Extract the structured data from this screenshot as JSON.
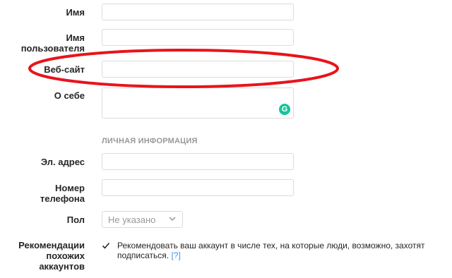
{
  "fields": {
    "name_label": "Имя",
    "username_label_line1": "Имя",
    "username_label_line2": "пользователя",
    "website_label": "Веб-сайт",
    "bio_label": "О себе",
    "email_label": "Эл. адрес",
    "phone_label_line1": "Номер",
    "phone_label_line2": "телефона",
    "gender_label": "Пол"
  },
  "private_section_title": "ЛИЧНАЯ ИНФОРМАЦИЯ",
  "gender_select": {
    "value": "Не указано"
  },
  "recommendations": {
    "label_line1": "Рекомендации",
    "label_line2": "похожих",
    "label_line3": "аккаунтов",
    "text": "Рекомендовать ваш аккаунт в числе тех, на которые люди, возможно, захотят подписаться.",
    "help": "[?]",
    "checked": true
  },
  "grammarly_glyph": "G",
  "icons": [
    "check-icon",
    "chevron-down-icon",
    "grammarly-icon"
  ],
  "colors": {
    "highlight_ellipse": "#e8141b",
    "border": "#dbdbdb",
    "link": "#3897f0",
    "grammarly": "#15c39a"
  }
}
